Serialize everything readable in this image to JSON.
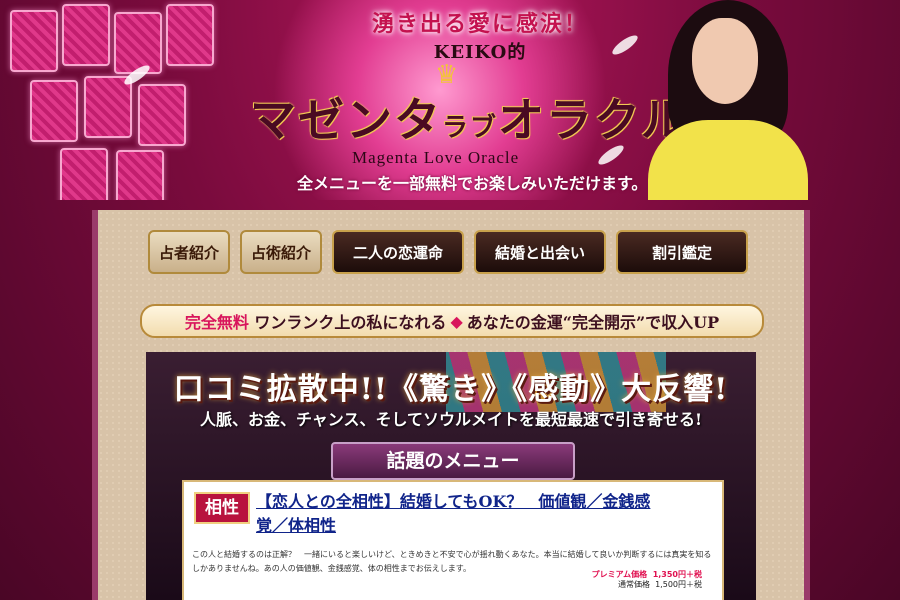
{
  "header": {
    "tagline_1": "湧き出る愛に感涙！",
    "tagline_2": "KEIKO的",
    "logo_main": "マゼンタ",
    "logo_small": "ラブ",
    "logo_end": "オラクル",
    "subtitle_en": "Magenta Love Oracle",
    "subtitle_jp": "全メニューを一部無料でお楽しみいただけます。"
  },
  "nav": {
    "items": [
      {
        "label": "占者紹介"
      },
      {
        "label": "占術紹介"
      },
      {
        "label": "二人の恋運命"
      },
      {
        "label": "結婚と出会い"
      },
      {
        "label": "割引鑑定"
      }
    ]
  },
  "banner": {
    "free": "完全無料",
    "part1": "ワンランク上の私になれる",
    "part2": "あなたの金運“完全開示”で収入UP"
  },
  "promo": {
    "headline": "口コミ拡散中!!《驚き》《感動》大反響!",
    "subline": "人脈、お金、チャンス、そしてソウルメイトを最短最速で引き寄せる!",
    "menu_title": "話題のメニュー"
  },
  "item": {
    "tag": "相性",
    "title": "【恋人との全相性】結婚してもOK？　価値観／金銭感覚／体相性",
    "description": "この人と結婚するのは正解？　一緒にいると楽しいけど、ときめきと不安で心が揺れ動くあなた。本当に結婚して良いか判断するには真実を知るしかありませんね。あの人の価値観、金銭感覚、体の相性までお伝えします。",
    "premium_label": "プレミアム価格",
    "premium_price": "1,350円＋税",
    "regular_label": "通常価格",
    "regular_price": "1,500円＋税"
  }
}
